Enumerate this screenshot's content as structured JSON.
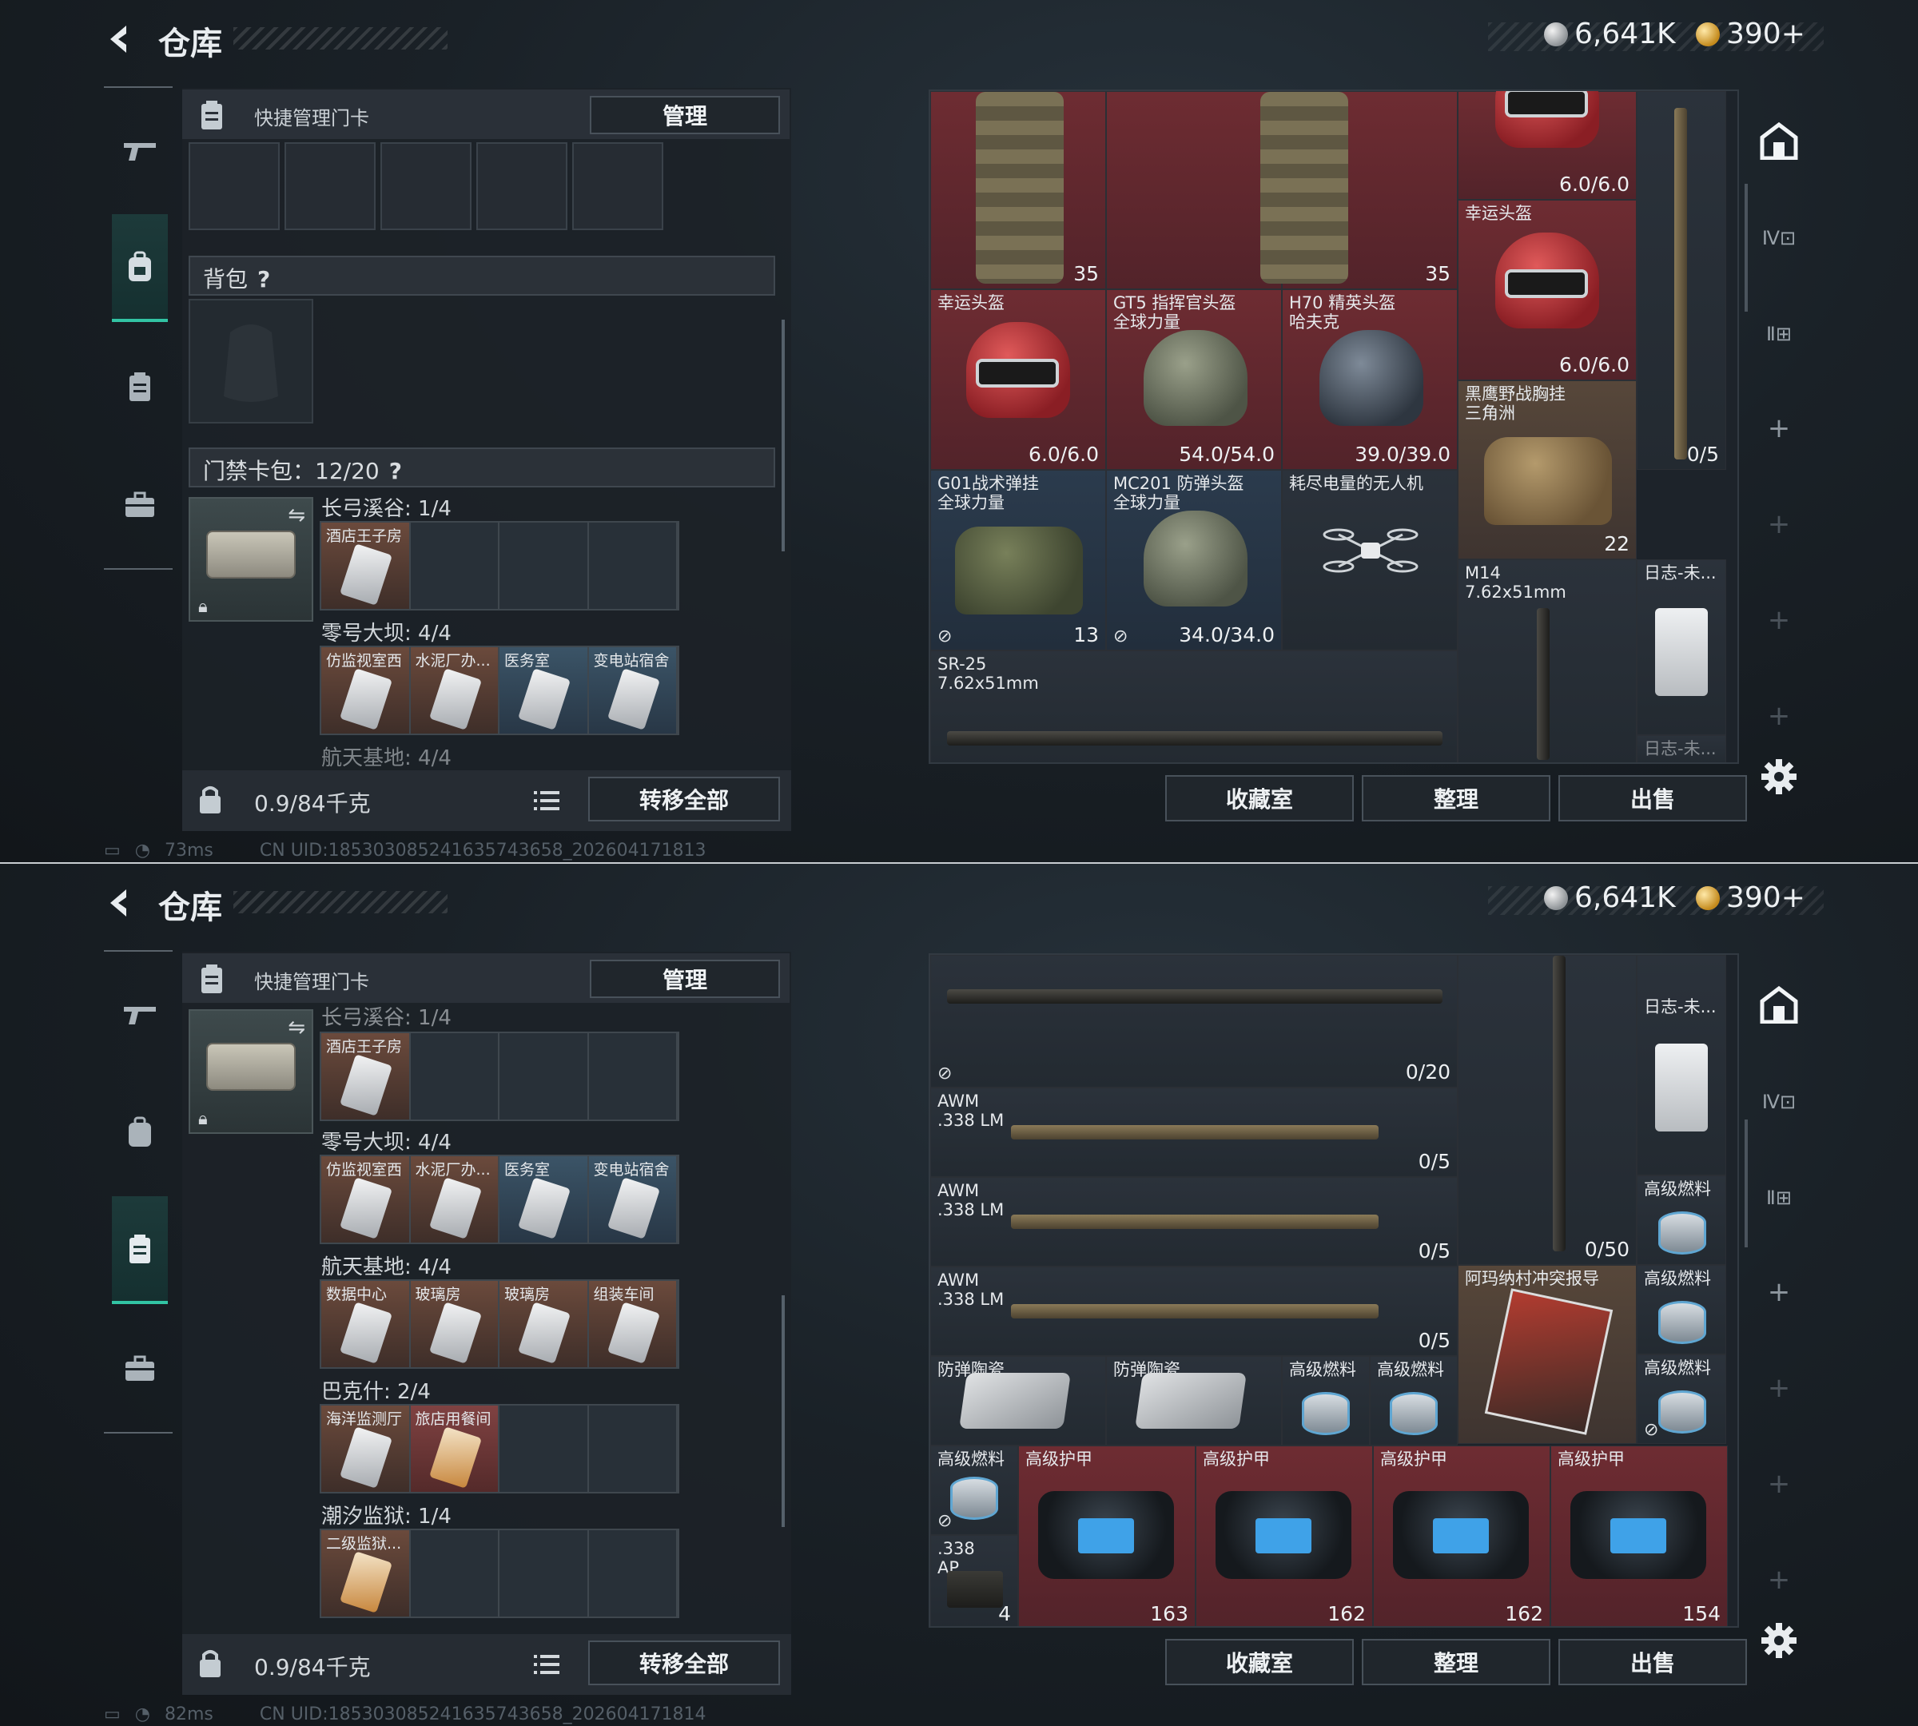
{
  "header": {
    "title": "仓库",
    "silver": "6,641K",
    "gold": "390+"
  },
  "quick_manage": {
    "label": "快捷管理门卡",
    "manage_btn": "管理"
  },
  "backpack": {
    "label": "背包",
    "help": "?"
  },
  "cardpack": {
    "label": "门禁卡包：12/20",
    "help": "?"
  },
  "locations": [
    {
      "name": "长弓溪谷: 1/4",
      "cards": [
        "酒店王子房",
        "",
        "",
        ""
      ]
    },
    {
      "name": "零号大坝: 4/4",
      "cards": [
        "仿监视室西",
        "水泥厂办...",
        "医务室",
        "变电站宿舍"
      ]
    },
    {
      "name": "航天基地: 4/4",
      "cards": [
        "数据中心",
        "玻璃房",
        "玻璃房",
        "组装车间"
      ]
    },
    {
      "name": "巴克什: 2/4",
      "cards": [
        "海洋监测厅",
        "旅店用餐间",
        "",
        ""
      ]
    },
    {
      "name": "潮汐监狱: 1/4",
      "cards": [
        "二级监狱...",
        "",
        "",
        ""
      ]
    }
  ],
  "footer": {
    "weight": "0.9/84千克",
    "transfer_btn": "转移全部"
  },
  "status": [
    {
      "ping": "73ms",
      "uid": "CN UID:185303085241635743658_202604171813"
    },
    {
      "ping": "82ms",
      "uid": "CN UID:185303085241635743658_202604171814"
    }
  ],
  "actions": {
    "collection": "收藏室",
    "sort": "整理",
    "sell": "出售"
  },
  "screen1_items": {
    "vest1_count": "35",
    "vest2_count": "35",
    "helmet_top": {
      "val": "6.0/6.0"
    },
    "lucky_helmet_r": {
      "name": "幸运头盔",
      "val": "6.0/6.0"
    },
    "lucky_helmet": {
      "name": "幸运头盔",
      "val": "6.0/6.0"
    },
    "gt5": {
      "name": "GT5 指挥官头盔\n全球力量",
      "val": "54.0/54.0"
    },
    "h70": {
      "name": "H70 精英头盔\n哈夫克",
      "val": "39.0/39.0"
    },
    "chest_rig": {
      "name": "黑鹰野战胸挂\n三角洲",
      "val": "22"
    },
    "sniper_v": {
      "val": "0/5"
    },
    "g01": {
      "name": "G01战术弹挂\n全球力量",
      "val": "13"
    },
    "mc201": {
      "name": "MC201 防弹头盔\n全球力量",
      "val": "34.0/34.0"
    },
    "drone": {
      "name": "耗尽电量的无人机"
    },
    "m14": {
      "name": "M14\n7.62x51mm"
    },
    "log1": {
      "name": "日志-未..."
    },
    "sr25": {
      "name": "SR-25\n7.62x51mm"
    },
    "log2": {
      "name": "日志-未..."
    }
  },
  "screen2_items": {
    "rifle_top": {
      "val": "0/20"
    },
    "m14_v": {
      "val": "0/50"
    },
    "log": {
      "name": "日志-未..."
    },
    "awm1": {
      "name": "AWM\n.338 LM",
      "val": "0/5"
    },
    "awm2": {
      "name": "AWM\n.338 LM",
      "val": "0/5"
    },
    "awm3": {
      "name": "AWM\n.338 LM",
      "val": "0/5"
    },
    "fuel_a": {
      "name": "高级燃料"
    },
    "fuel_b": {
      "name": "高级燃料"
    },
    "report": {
      "name": "阿玛纳村冲突报导"
    },
    "plate1": {
      "name": "防弹陶瓷"
    },
    "plate2": {
      "name": "防弹陶瓷"
    },
    "fuel_c": {
      "name": "高级燃料"
    },
    "fuel_d": {
      "name": "高级燃料"
    },
    "fuel_e": {
      "name": "高级燃料"
    },
    "fuel_f": {
      "name": "高级燃料"
    },
    "ammo": {
      "name": ".338\nAP",
      "val": "4"
    },
    "armor1": {
      "name": "高级护甲",
      "val": "163"
    },
    "armor2": {
      "name": "高级护甲",
      "val": "162"
    },
    "armor3": {
      "name": "高级护甲",
      "val": "162"
    },
    "armor4": {
      "name": "高级护甲",
      "val": "154"
    }
  }
}
